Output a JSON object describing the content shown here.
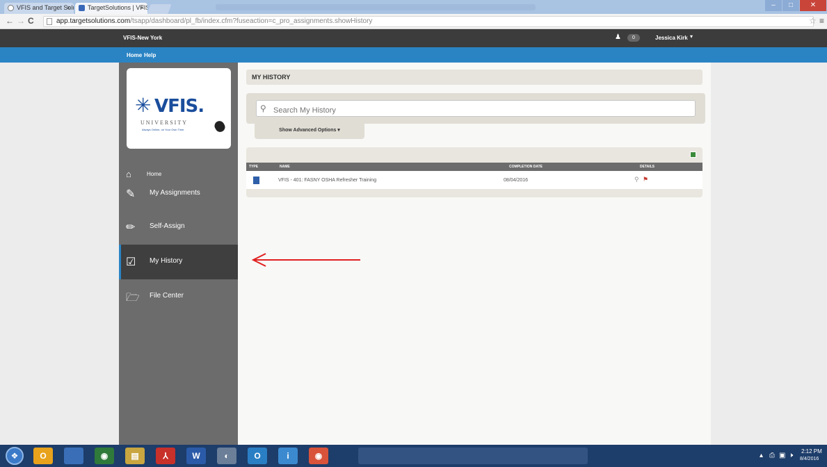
{
  "browser": {
    "tabs": [
      {
        "label": "VFIS and Target Solutions"
      },
      {
        "label": "TargetSolutions | VFIS-Ne"
      }
    ],
    "tab_close": "×",
    "window_controls": {
      "minimize": "–",
      "maximize": "□",
      "close": "✕"
    },
    "nav": {
      "back": "←",
      "forward": "→",
      "reload": "C"
    },
    "url_host": "app.targetsolutions.com",
    "url_path": "/tsapp/dashboard/pl_fb/index.cfm?fuseaction=c_pro_assignments.showHistory",
    "star_glyph": "☆",
    "menu_glyph": "≡"
  },
  "header": {
    "org_name": "VFIS-New York",
    "notification_count": "0",
    "user_name": "Jessica Kirk",
    "user_caret": "▾"
  },
  "topnav": {
    "home": "Home",
    "help": "Help"
  },
  "logo": {
    "word": "VFIS.",
    "sub": "UNIVERSITY",
    "tagline": "Always Online, on Your Own Time."
  },
  "sidebar": {
    "items": [
      {
        "label": "Home",
        "icon": "home-icon"
      },
      {
        "label": "My Assignments",
        "icon": "edit-icon"
      },
      {
        "label": "Self-Assign",
        "icon": "pencil-icon"
      },
      {
        "label": "My History",
        "icon": "check-square-icon"
      },
      {
        "label": "File Center",
        "icon": "folder-open-icon"
      }
    ],
    "active": "My History"
  },
  "main": {
    "title": "MY HISTORY",
    "search_placeholder": "Search My History",
    "advanced_label": "Show Advanced Options ▾",
    "table": {
      "columns": [
        "TYPE",
        "NAME",
        "COMPLETION DATE",
        "DETAILS"
      ],
      "rows": [
        {
          "name": "VFIS - 401: FASNY OSHA Refresher Training",
          "date": "08/04/2016"
        }
      ]
    }
  },
  "taskbar": {
    "apps": [
      {
        "label": "O",
        "color": "#e8a21b"
      },
      {
        "label": "",
        "color": "#3a6fb8"
      },
      {
        "label": "◉",
        "color": "#2f7a3a"
      },
      {
        "label": "▤",
        "color": "#c9a640"
      },
      {
        "label": "⅄",
        "color": "#c8302a"
      },
      {
        "label": "W",
        "color": "#2b5ba8"
      },
      {
        "label": "◐",
        "color": "#6b7f99"
      },
      {
        "label": "O",
        "color": "#2a7fc4"
      },
      {
        "label": "i",
        "color": "#3b8ad0"
      },
      {
        "label": "◉",
        "color": "#d8533a"
      }
    ],
    "time": "2:12 PM",
    "date": "8/4/2016"
  },
  "colors": {
    "accent": "#2a84c4",
    "topbar": "#3c3c3c",
    "sidebar": "#6c6c6c",
    "active_item": "#3f3f3f",
    "arrow": "#e02020"
  }
}
